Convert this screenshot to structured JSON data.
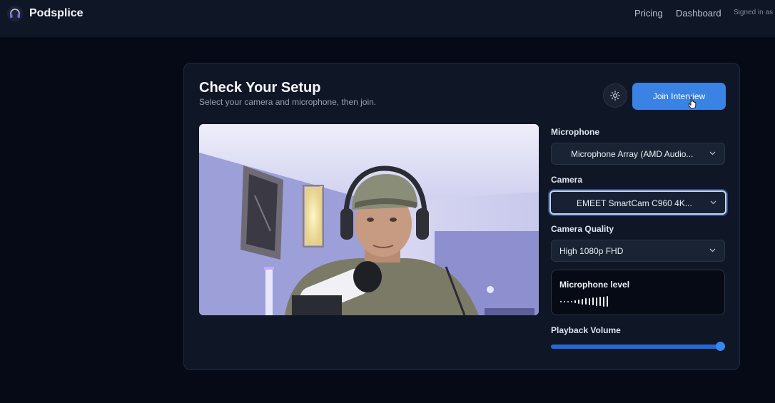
{
  "header": {
    "brand_name": "Podsplice",
    "nav": {
      "pricing": "Pricing",
      "dashboard": "Dashboard"
    },
    "signed_in_text": "Signed in as"
  },
  "setup": {
    "title": "Check Your Setup",
    "subtitle": "Select your camera and microphone, then join.",
    "join_button": "Join Interview",
    "microphone": {
      "label": "Microphone",
      "selected": "Microphone Array (AMD Audio..."
    },
    "camera": {
      "label": "Camera",
      "selected": "EMEET SmartCam C960 4K..."
    },
    "camera_quality": {
      "label": "Camera Quality",
      "selected": "High 1080p FHD"
    },
    "mic_level": {
      "title": "Microphone level",
      "level_fraction": 0.6
    },
    "playback": {
      "label": "Playback Volume",
      "volume_fraction": 1.0
    }
  },
  "colors": {
    "accent": "#3a82e4",
    "background": "#060a17",
    "card": "#0f1726"
  },
  "icons": {
    "brand": "headphones-icon",
    "theme": "sun-icon",
    "dropdown": "chevron-down-icon",
    "cursor": "hand-pointer-icon"
  }
}
